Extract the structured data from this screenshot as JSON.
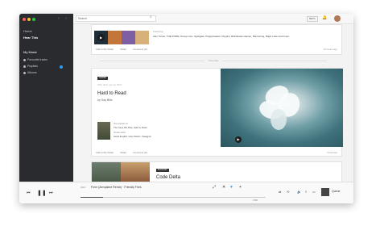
{
  "sidebar": {
    "items": [
      {
        "label": "Home"
      },
      {
        "label": "Hear This"
      },
      {
        "label": "My Music"
      },
      {
        "label": "Favourite tracks"
      },
      {
        "label": "Playlists"
      },
      {
        "label": "Albums"
      }
    ]
  },
  "topbar": {
    "search_placeholder": "Search",
    "beta_label": "BETA"
  },
  "feed": {
    "card1": {
      "featuring_label": "Featuring",
      "featuring_names": "Alex Turner, THE KNIFE, Snoop Lion, Spotigate, Puppetmaster, Puppini, Rishikesan Heinen, Marmoring, Major Lazer and more",
      "actions": [
        "Add to My Music",
        "Share",
        "Comment (0)"
      ],
      "ago": "13 hours ago"
    },
    "separator": "Yesterday",
    "card2": {
      "tag": "ALBUM",
      "why": "Why don't you try this?",
      "title": "Hard to Read",
      "artist": "by Gay Blitz",
      "meta1_label": "Also appears on",
      "meta1_value": "The Gays We Rise, Hard to Read",
      "meta2_label": "Similar artists",
      "meta2_value": "Hazel English, Holy Sisters, Spaggino",
      "actions": [
        "Add to My Music",
        "Share",
        "Comment (0)"
      ],
      "ago": "Yesterday"
    },
    "card3": {
      "tag": "PLAYLIST",
      "title": "Code Delta"
    }
  },
  "player": {
    "track": "Form (Aeroplane Remix) · Friendly Fires",
    "time_elapsed": "0:24",
    "time_total": "3:58",
    "progress": 0.12,
    "queue_label": "Queue"
  },
  "colors": {
    "sidebar_bg": "#2a2b2f",
    "accent_blue": "#2f9bf0"
  }
}
